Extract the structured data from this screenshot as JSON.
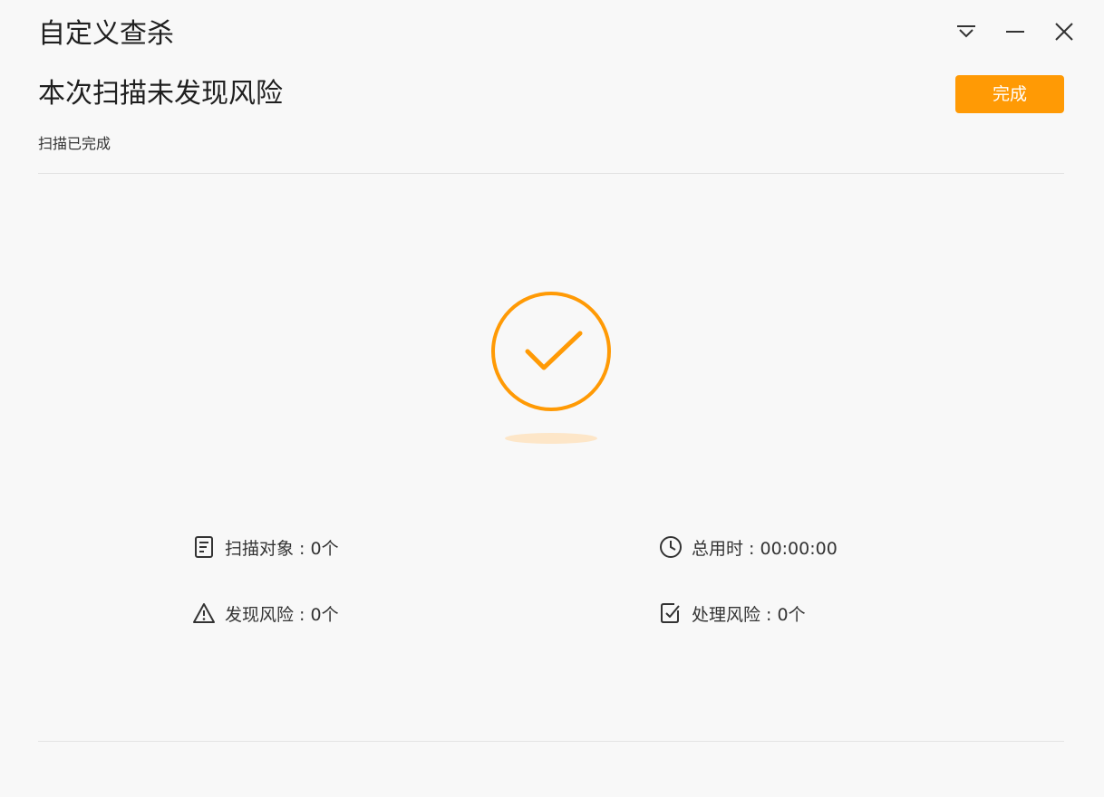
{
  "window": {
    "title": "自定义查杀",
    "controls": [
      "dropdown-icon",
      "minimize-icon",
      "close-icon"
    ]
  },
  "result": {
    "headline": "本次扫描未发现风险",
    "status": "扫描已完成",
    "finish_label": "完成",
    "accent_color": "#ff9a05"
  },
  "stats": {
    "scanned_objects": "扫描对象 : 0个",
    "total_time": "总用时 : 00:00:00",
    "risks_found": "发现风险 : 0个",
    "risks_handled": "处理风险 : 0个",
    "icons": [
      "document-icon",
      "clock-icon",
      "warning-icon",
      "checkbox-icon"
    ]
  }
}
